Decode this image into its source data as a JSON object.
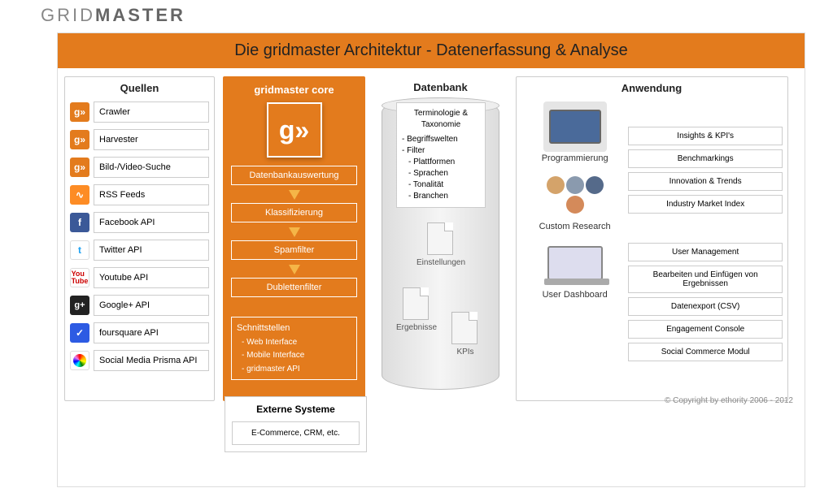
{
  "brand": {
    "part1": "GRID",
    "part2": "MASTER"
  },
  "title": "Die gridmaster Architektur - Datenerfassung & Analyse",
  "columns": {
    "sources": "Quellen",
    "core": "gridmaster core",
    "database": "Datenbank",
    "application": "Anwendung"
  },
  "sources": {
    "crawler": "Crawler",
    "harvester": "Harvester",
    "bildvideo": "Bild-/Video-Suche",
    "rss": "RSS Feeds",
    "facebook": "Facebook API",
    "twitter": "Twitter API",
    "youtube": "Youtube API",
    "googleplus": "Google+ API",
    "foursquare": "foursquare API",
    "prisma": "Social Media Prisma API"
  },
  "core": {
    "logo": "g»",
    "db_eval": "Datenbankauswertung",
    "classify": "Klassifizierung",
    "spam": "Spamfilter",
    "dublette": "Dublettenfilter",
    "interfaces_title": "Schnittstellen",
    "interfaces": [
      "- Web Interface",
      "- Mobile Interface",
      "- gridmaster API"
    ]
  },
  "external": {
    "title": "Externe Systeme",
    "content": "E-Commerce, CRM, etc."
  },
  "database": {
    "taxonomy_title": "Terminologie & Taxonomie",
    "taxonomy_items": [
      "- Begriffswelten",
      "- Filter",
      "  - Plattformen",
      "  - Sprachen",
      "  - Tonalität",
      "  - Branchen"
    ],
    "settings": "Einstellungen",
    "results": "Ergebnisse",
    "kpis": "KPIs"
  },
  "application": {
    "programming": "Programmierung",
    "custom_research": "Custom Research",
    "user_dashboard": "User Dashboard",
    "outputs": {
      "insights": "Insights & KPI's",
      "benchmarkings": "Benchmarkings",
      "innovation": "Innovation & Trends",
      "market_index": "Industry Market Index",
      "user_mgmt": "User Management",
      "editing": "Bearbeiten und Einfügen von Ergebnissen",
      "export": "Datenexport (CSV)",
      "engagement": "Engagement Console",
      "commerce": "Social Commerce Modul"
    }
  },
  "copyright": "© Copyright by ethority 2006 - 2012"
}
